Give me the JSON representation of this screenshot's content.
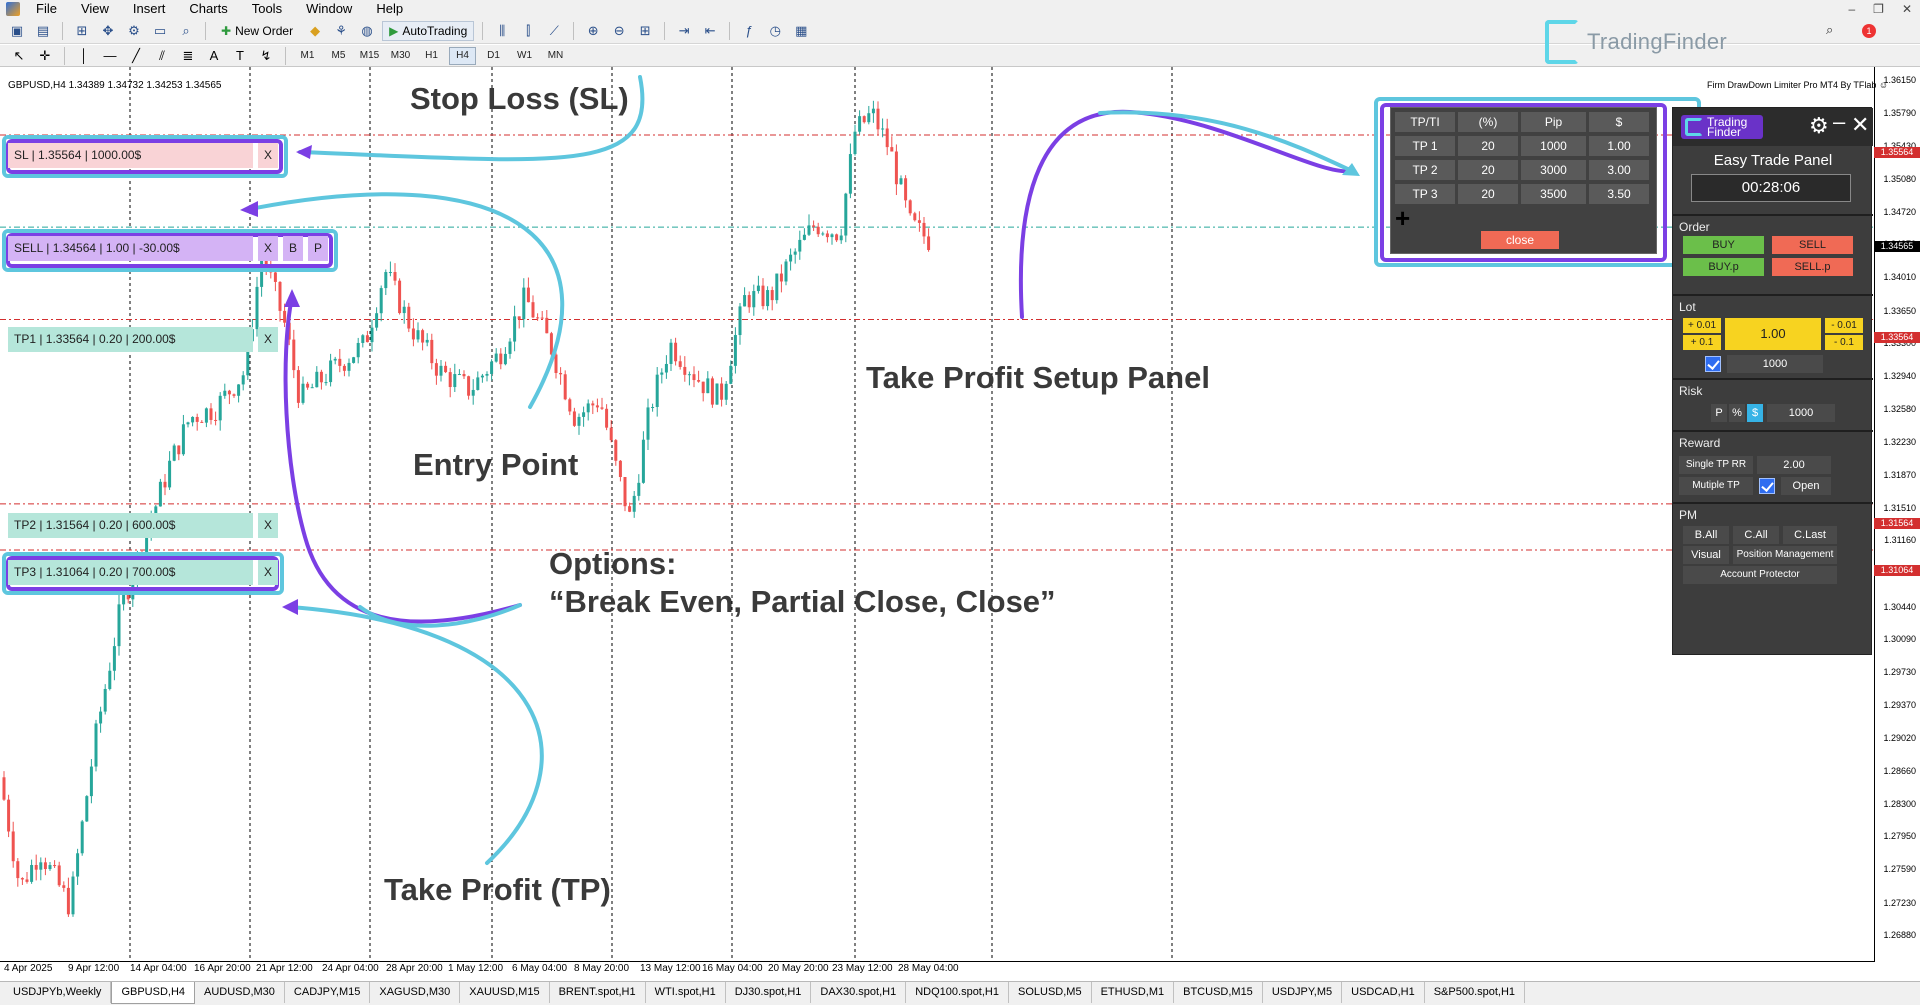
{
  "menu": {
    "items": [
      "File",
      "View",
      "Insert",
      "Charts",
      "Tools",
      "Window",
      "Help"
    ]
  },
  "toolbar": {
    "new_order": "New Order",
    "auto_trading": "AutoTrading",
    "timeframes": [
      "M1",
      "M5",
      "M15",
      "M30",
      "H1",
      "H4",
      "D1",
      "W1",
      "MN"
    ],
    "active_timeframe": "H4"
  },
  "watermark": {
    "text": "TradingFinder"
  },
  "chart": {
    "title": "GBPUSD,H4  1.34389 1.34732 1.34253 1.34565",
    "indicator_title": "Firm DrawDown Limiter Pro MT4 By TFlab",
    "price_labels": [
      "1.36150",
      "1.35790",
      "1.35430",
      "1.35080",
      "1.34720",
      "1.34370",
      "1.34010",
      "1.33650",
      "1.33300",
      "1.32940",
      "1.32580",
      "1.32230",
      "1.31870",
      "1.31510",
      "1.31160",
      "1.30800",
      "1.30440",
      "1.30090",
      "1.29730",
      "1.29370",
      "1.29020",
      "1.28660",
      "1.28300",
      "1.27950",
      "1.27590",
      "1.27230",
      "1.26880"
    ],
    "line_labels": {
      "sl": "1.35564",
      "entry": "1.34565",
      "tp1": "1.33564",
      "tp2": "1.31564",
      "tp3": "1.31064"
    },
    "dates": [
      "4 Apr 2025",
      "9 Apr 12:00",
      "14 Apr 04:00",
      "16 Apr 20:00",
      "21 Apr 12:00",
      "24 Apr 04:00",
      "28 Apr 20:00",
      "1 May 12:00",
      "6 May 04:00",
      "8 May 20:00",
      "13 May 12:00",
      "16 May 04:00",
      "20 May 20:00",
      "23 May 12:00",
      "28 May 04:00"
    ]
  },
  "trade_boxes": {
    "sl": "SL | 1.35564 | 1000.00$",
    "sell": "SELL | 1.34564 | 1.00 | -30.00$",
    "tp1": "TP1 | 1.33564 | 0.20 | 200.00$",
    "tp2": "TP2 | 1.31564 | 0.20 | 600.00$",
    "tp3": "TP3 | 1.31064 | 0.20 | 700.00$",
    "x": "X",
    "b": "B",
    "p": "P"
  },
  "annotations": {
    "stop_loss": "Stop Loss (SL)",
    "entry_point": "Entry Point",
    "options_title": "Options:",
    "options_body": "“Break Even, Partial Close, Close”",
    "take_profit": "Take Profit (TP)",
    "tp_setup_panel": "Take Profit Setup Panel"
  },
  "tp_panel": {
    "headers": [
      "TP/TI",
      "(%)",
      "Pip",
      "$"
    ],
    "rows": [
      [
        "TP 1",
        "20",
        "1000",
        "1.00"
      ],
      [
        "TP 2",
        "20",
        "3000",
        "3.00"
      ],
      [
        "TP 3",
        "20",
        "3500",
        "3.50"
      ]
    ],
    "add_icon": "+",
    "close": "close"
  },
  "easy_panel": {
    "logo_line1": "Trading",
    "logo_line2": "Finder",
    "title": "Easy Trade Panel",
    "timer": "00:28:06",
    "order_label": "Order",
    "buy": "BUY",
    "sell": "SELL",
    "buy_p": "BUY.p",
    "sell_p": "SELL.p",
    "lot_label": "Lot",
    "plus_001": "+ 0.01",
    "plus_01": "+ 0.1",
    "lot_value": "1.00",
    "minus_001": "- 0.01",
    "minus_01": "- 0.1",
    "lot_amount": "1000",
    "risk_label": "Risk",
    "risk_p": "P",
    "risk_pct": "%",
    "risk_usd": "$",
    "risk_value": "1000",
    "reward_label": "Reward",
    "single_tp_rr": "Single TP RR",
    "rr_value": "2.00",
    "multiple_tp": "Mutiple TP",
    "open": "Open",
    "pm_label": "PM",
    "b_all": "B.All",
    "c_all": "C.All",
    "c_last": "C.Last",
    "visual": "Visual",
    "position_management": "Position Management",
    "account_protector": "Account Protector"
  },
  "tabs": [
    "USDJPYb,Weekly",
    "GBPUSD,H4",
    "AUDUSD,M30",
    "CADJPY,M15",
    "XAGUSD,M30",
    "XAUUSD,M15",
    "BRENT.spot,H1",
    "WTI.spot,H1",
    "DJ30.spot,H1",
    "DAX30.spot,H1",
    "NDQ100.spot,H1",
    "SOLUSD,M5",
    "ETHUSD,M1",
    "BTCUSD,M15",
    "USDJPY,M5",
    "USDCAD,H1",
    "S&P500.spot,H1"
  ],
  "active_tab": "GBPUSD,H4",
  "colors": {
    "bull": "#26a69a",
    "bear": "#ef5350",
    "frame_cyan": "#5ec6de",
    "frame_purple": "#7b3fe4",
    "sl_level": "#d32f2f",
    "entry_level": "#26a69a"
  }
}
